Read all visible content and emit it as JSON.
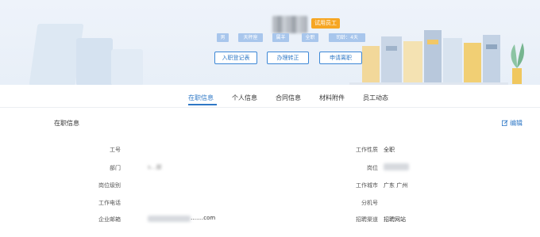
{
  "header": {
    "status_tag": "试用员工",
    "tags": [
      "男",
      "天秤座",
      "属羊",
      "全职",
      "司龄：4天"
    ],
    "actions": [
      "入职登记表",
      "办理转正",
      "申请离职"
    ]
  },
  "tabs": [
    "在职信息",
    "个人信息",
    "合同信息",
    "材料附件",
    "员工动态"
  ],
  "active_tab": "在职信息",
  "section": {
    "title": "在职信息",
    "edit_label": "编辑"
  },
  "fields": {
    "employee_no": {
      "label": "工号",
      "value": ""
    },
    "department": {
      "label": "部门",
      "value": "s…部"
    },
    "job_level": {
      "label": "岗位级别",
      "value": ""
    },
    "work_phone": {
      "label": "工作电话",
      "value": ""
    },
    "company_email": {
      "label": "企业邮箱",
      "value": "…….com"
    },
    "employment_type": {
      "label": "工作性质",
      "value": "全职"
    },
    "position": {
      "label": "岗位",
      "value": ""
    },
    "work_city": {
      "label": "工作城市",
      "value": "广东  广州"
    },
    "extension": {
      "label": "分机号",
      "value": ""
    },
    "recruit_channel": {
      "label": "招聘渠道",
      "value": "招聘网站"
    }
  },
  "colors": {
    "accent": "#2f78c6",
    "status_tag": "#f6a623",
    "tag_bg": "#a8c6ec"
  }
}
